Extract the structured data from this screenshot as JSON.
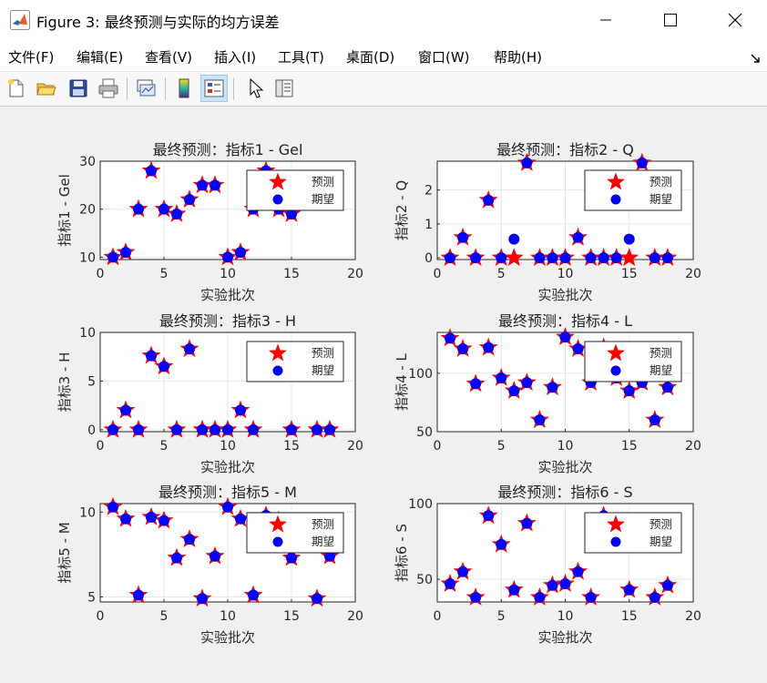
{
  "window": {
    "title": "Figure 3: 最终预测与实际的均方误差",
    "controls": {
      "minimize": "minimize",
      "maximize": "maximize",
      "close": "close"
    }
  },
  "menu": [
    {
      "id": "file",
      "label": "文件(F)"
    },
    {
      "id": "edit",
      "label": "编辑(E)"
    },
    {
      "id": "view",
      "label": "查看(V)"
    },
    {
      "id": "insert",
      "label": "插入(I)"
    },
    {
      "id": "tools",
      "label": "工具(T)"
    },
    {
      "id": "desktop",
      "label": "桌面(D)"
    },
    {
      "id": "window",
      "label": "窗口(W)"
    },
    {
      "id": "help",
      "label": "帮助(H)"
    }
  ],
  "toolbar": [
    {
      "id": "new-figure",
      "icon": "new-file-icon"
    },
    {
      "id": "open-file",
      "icon": "open-folder-icon"
    },
    {
      "id": "save-figure",
      "icon": "save-disk-icon"
    },
    {
      "id": "print-figure",
      "icon": "printer-icon"
    },
    {
      "id": "link-plot",
      "icon": "link-plot-icon"
    },
    {
      "id": "insert-colorbar",
      "icon": "colorbar-icon"
    },
    {
      "id": "insert-legend",
      "icon": "legend-icon",
      "active": true
    },
    {
      "id": "edit-plot",
      "icon": "pointer-arrow-icon"
    },
    {
      "id": "property-inspector",
      "icon": "property-inspector-icon"
    }
  ],
  "colors": {
    "predicted": "#ff0000",
    "expected": "#0000ff",
    "axes_bg": "#ffffff",
    "grid": "#e6e6e6",
    "figure_bg": "#f0f0f0"
  },
  "chart_data": [
    {
      "type": "scatter",
      "title": "最终预测：指标1 - Gel",
      "xlabel": "实验批次",
      "ylabel": "指标1 - Gel",
      "xlim": [
        0,
        20
      ],
      "ylim": [
        9.5,
        30
      ],
      "xticks": [
        0,
        5,
        10,
        15,
        20
      ],
      "yticks": [
        10,
        20,
        30
      ],
      "grid": true,
      "legend_position": "top-right",
      "x": [
        1,
        2,
        3,
        4,
        5,
        6,
        7,
        8,
        9,
        10,
        11,
        12,
        13,
        14,
        15
      ],
      "series": [
        {
          "name": "预测",
          "marker": "star",
          "color": "#ff0000",
          "values": [
            10,
            11,
            20,
            28,
            20,
            19,
            22,
            25,
            25,
            10,
            11,
            20,
            28,
            20,
            19
          ]
        },
        {
          "name": "期望",
          "marker": "circle",
          "color": "#0000ff",
          "values": [
            10,
            11,
            20,
            28,
            20,
            19,
            22,
            25,
            25,
            10,
            11,
            20,
            28,
            20,
            19
          ]
        }
      ]
    },
    {
      "type": "scatter",
      "title": "最终预测：指标2 - Q",
      "xlabel": "实验批次",
      "ylabel": "指标2 - Q",
      "xlim": [
        0,
        20
      ],
      "ylim": [
        -0.05,
        2.85
      ],
      "xticks": [
        0,
        5,
        10,
        15,
        20
      ],
      "yticks": [
        0,
        1,
        2
      ],
      "grid": true,
      "legend_position": "top-right",
      "x": [
        1,
        2,
        3,
        4,
        5,
        6,
        7,
        8,
        9,
        10,
        11,
        12,
        13,
        14,
        15,
        16,
        17,
        18
      ],
      "series": [
        {
          "name": "预测",
          "marker": "star",
          "color": "#ff0000",
          "values": [
            0,
            0.6,
            0,
            1.7,
            0,
            0,
            2.8,
            0,
            0,
            0,
            0.6,
            0,
            0,
            0,
            0,
            2.8,
            0,
            0
          ]
        },
        {
          "name": "期望",
          "marker": "circle",
          "color": "#0000ff",
          "values": [
            0,
            0.6,
            0,
            1.7,
            0,
            0.55,
            2.8,
            0,
            0,
            0,
            0.6,
            0,
            0,
            0,
            0.55,
            2.8,
            0,
            0
          ]
        }
      ]
    },
    {
      "type": "scatter",
      "title": "最终预测：指标3 - H",
      "xlabel": "实验批次",
      "ylabel": "指标3 - H",
      "xlim": [
        0,
        20
      ],
      "ylim": [
        -0.2,
        10
      ],
      "xticks": [
        0,
        5,
        10,
        15,
        20
      ],
      "yticks": [
        0,
        5,
        10
      ],
      "grid": true,
      "legend_position": "top-right",
      "x": [
        1,
        2,
        3,
        4,
        5,
        6,
        7,
        8,
        9,
        10,
        11,
        12,
        15,
        17,
        18
      ],
      "series": [
        {
          "name": "预测",
          "marker": "star",
          "color": "#ff0000",
          "values": [
            0,
            2,
            0,
            7.6,
            6.5,
            0,
            8.3,
            0,
            0,
            0,
            2,
            0,
            0,
            0,
            0
          ]
        },
        {
          "name": "期望",
          "marker": "circle",
          "color": "#0000ff",
          "values": [
            0,
            2,
            0,
            7.6,
            6.5,
            0,
            8.3,
            0,
            0,
            0,
            2,
            0,
            0,
            0,
            0
          ]
        }
      ]
    },
    {
      "type": "scatter",
      "title": "最终预测：指标4 - L",
      "xlabel": "实验批次",
      "ylabel": "指标4 - L",
      "xlim": [
        0,
        20
      ],
      "ylim": [
        50,
        135
      ],
      "xticks": [
        0,
        5,
        10,
        15,
        20
      ],
      "yticks": [
        50,
        100
      ],
      "grid": true,
      "legend_position": "top-right",
      "x": [
        1,
        2,
        3,
        4,
        5,
        6,
        7,
        8,
        9,
        10,
        11,
        12,
        13,
        14,
        15,
        16,
        17,
        18
      ],
      "series": [
        {
          "name": "预测",
          "marker": "star",
          "color": "#ff0000",
          "values": [
            130,
            121,
            91,
            122,
            96,
            85,
            92,
            60,
            88,
            131,
            121,
            92,
            122,
            96,
            85,
            92,
            60,
            88
          ]
        },
        {
          "name": "期望",
          "marker": "circle",
          "color": "#0000ff",
          "values": [
            130,
            121,
            91,
            122,
            96,
            85,
            92,
            60,
            88,
            131,
            121,
            92,
            122,
            96,
            85,
            92,
            60,
            88
          ]
        }
      ]
    },
    {
      "type": "scatter",
      "title": "最终预测：指标5 - M",
      "xlabel": "实验批次",
      "ylabel": "指标5 - M",
      "xlim": [
        0,
        20
      ],
      "ylim": [
        4.7,
        10.5
      ],
      "xticks": [
        0,
        5,
        10,
        15,
        20
      ],
      "yticks": [
        5,
        10
      ],
      "grid": true,
      "legend_position": "top-right",
      "x": [
        1,
        2,
        3,
        4,
        5,
        6,
        7,
        8,
        9,
        10,
        11,
        12,
        13,
        14,
        15,
        16,
        17,
        18
      ],
      "series": [
        {
          "name": "预测",
          "marker": "star",
          "color": "#ff0000",
          "values": [
            10.3,
            9.6,
            5.1,
            9.7,
            9.5,
            7.3,
            8.4,
            4.9,
            7.4,
            10.3,
            9.6,
            5.1,
            9.8,
            9.5,
            7.3,
            8.4,
            4.9,
            7.4
          ]
        },
        {
          "name": "期望",
          "marker": "circle",
          "color": "#0000ff",
          "values": [
            10.3,
            9.6,
            5.1,
            9.7,
            9.5,
            7.3,
            8.4,
            4.9,
            7.4,
            10.3,
            9.6,
            5.1,
            9.8,
            9.5,
            7.3,
            8.4,
            4.9,
            7.4
          ]
        }
      ]
    },
    {
      "type": "scatter",
      "title": "最终预测：指标6 - S",
      "xlabel": "实验批次",
      "ylabel": "指标6 - S",
      "xlim": [
        0,
        20
      ],
      "ylim": [
        35,
        100
      ],
      "xticks": [
        0,
        5,
        10,
        15,
        20
      ],
      "yticks": [
        50,
        100
      ],
      "grid": true,
      "legend_position": "top-right",
      "x": [
        1,
        2,
        3,
        4,
        5,
        6,
        7,
        8,
        9,
        10,
        11,
        12,
        13,
        15,
        17,
        18
      ],
      "series": [
        {
          "name": "预测",
          "marker": "star",
          "color": "#ff0000",
          "values": [
            47,
            55,
            38,
            92,
            73,
            43,
            87,
            38,
            46,
            47,
            55,
            38,
            92,
            43,
            38,
            46
          ]
        },
        {
          "name": "期望",
          "marker": "circle",
          "color": "#0000ff",
          "values": [
            47,
            55,
            38,
            92,
            73,
            43,
            87,
            38,
            46,
            47,
            55,
            38,
            92,
            43,
            38,
            46
          ]
        }
      ]
    }
  ]
}
